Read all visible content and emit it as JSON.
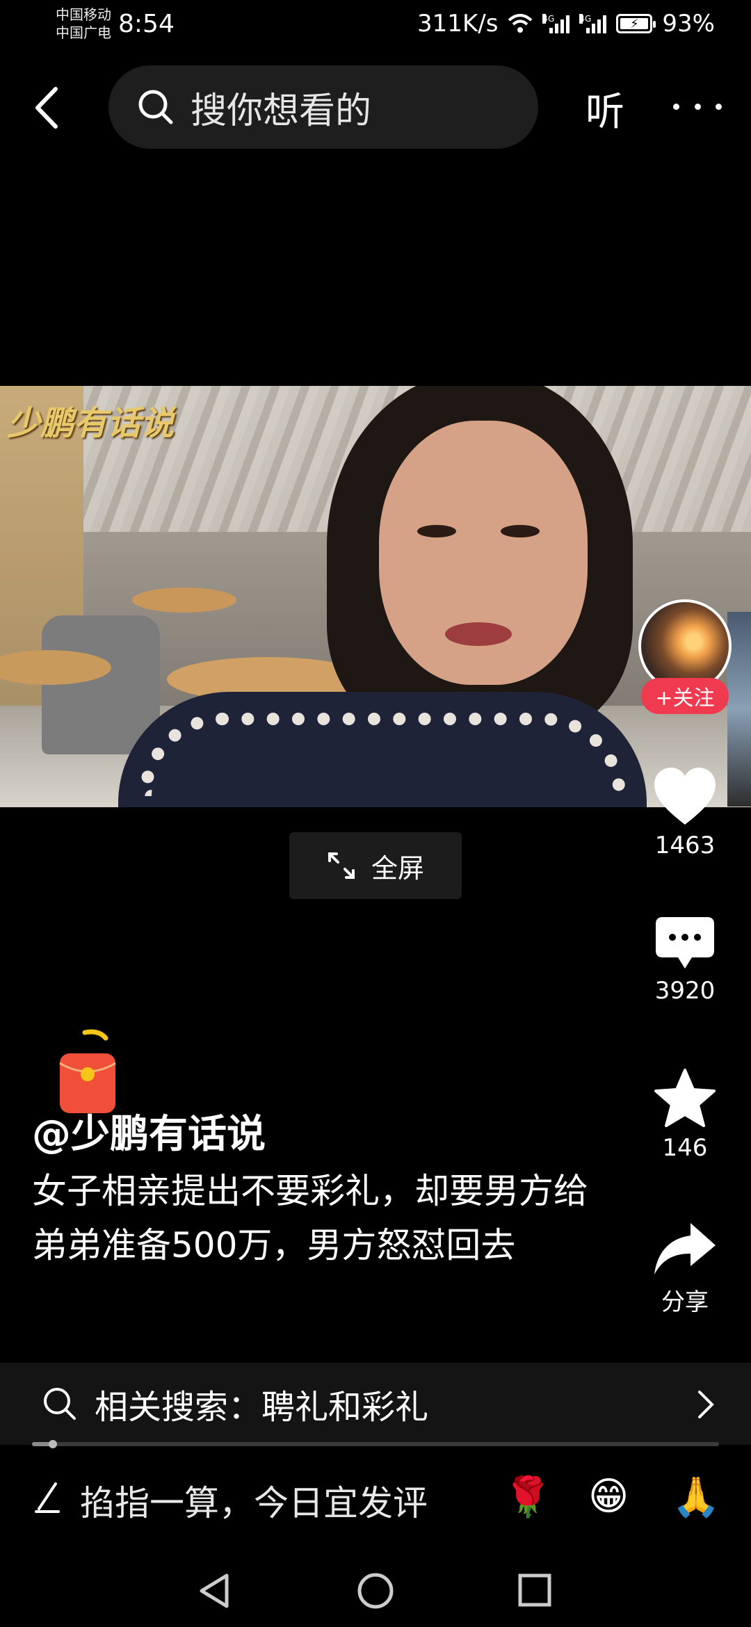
{
  "status_bar": {
    "carrier_1": "中国移动",
    "carrier_2": "中国广电",
    "time": "8:54",
    "net_speed": "311K/s",
    "signal_tag": "4G",
    "battery": "93%"
  },
  "top_bar": {
    "search_placeholder": "搜你想看的",
    "listen_label": "听"
  },
  "video": {
    "watermark": "少鹏有话说",
    "fullscreen_label": "全屏"
  },
  "rail": {
    "follow_label": "+关注",
    "likes": "1463",
    "comments": "3920",
    "favorites": "146",
    "share_label": "分享"
  },
  "caption": {
    "author": "@少鹏有话说",
    "description": "女子相亲提出不要彩礼，却要男方给弟弟准备500万，男方怒怼回去"
  },
  "related_search": {
    "label": "相关搜索：聘礼和彩礼"
  },
  "progress": {
    "fraction": 0.03
  },
  "comment_bar": {
    "prompt": "掐指一算，今日宜发评",
    "emojis": [
      "🌹",
      "😁",
      "🙏"
    ]
  },
  "colors": {
    "accent_red": "#f03a4f",
    "background": "#000000"
  }
}
